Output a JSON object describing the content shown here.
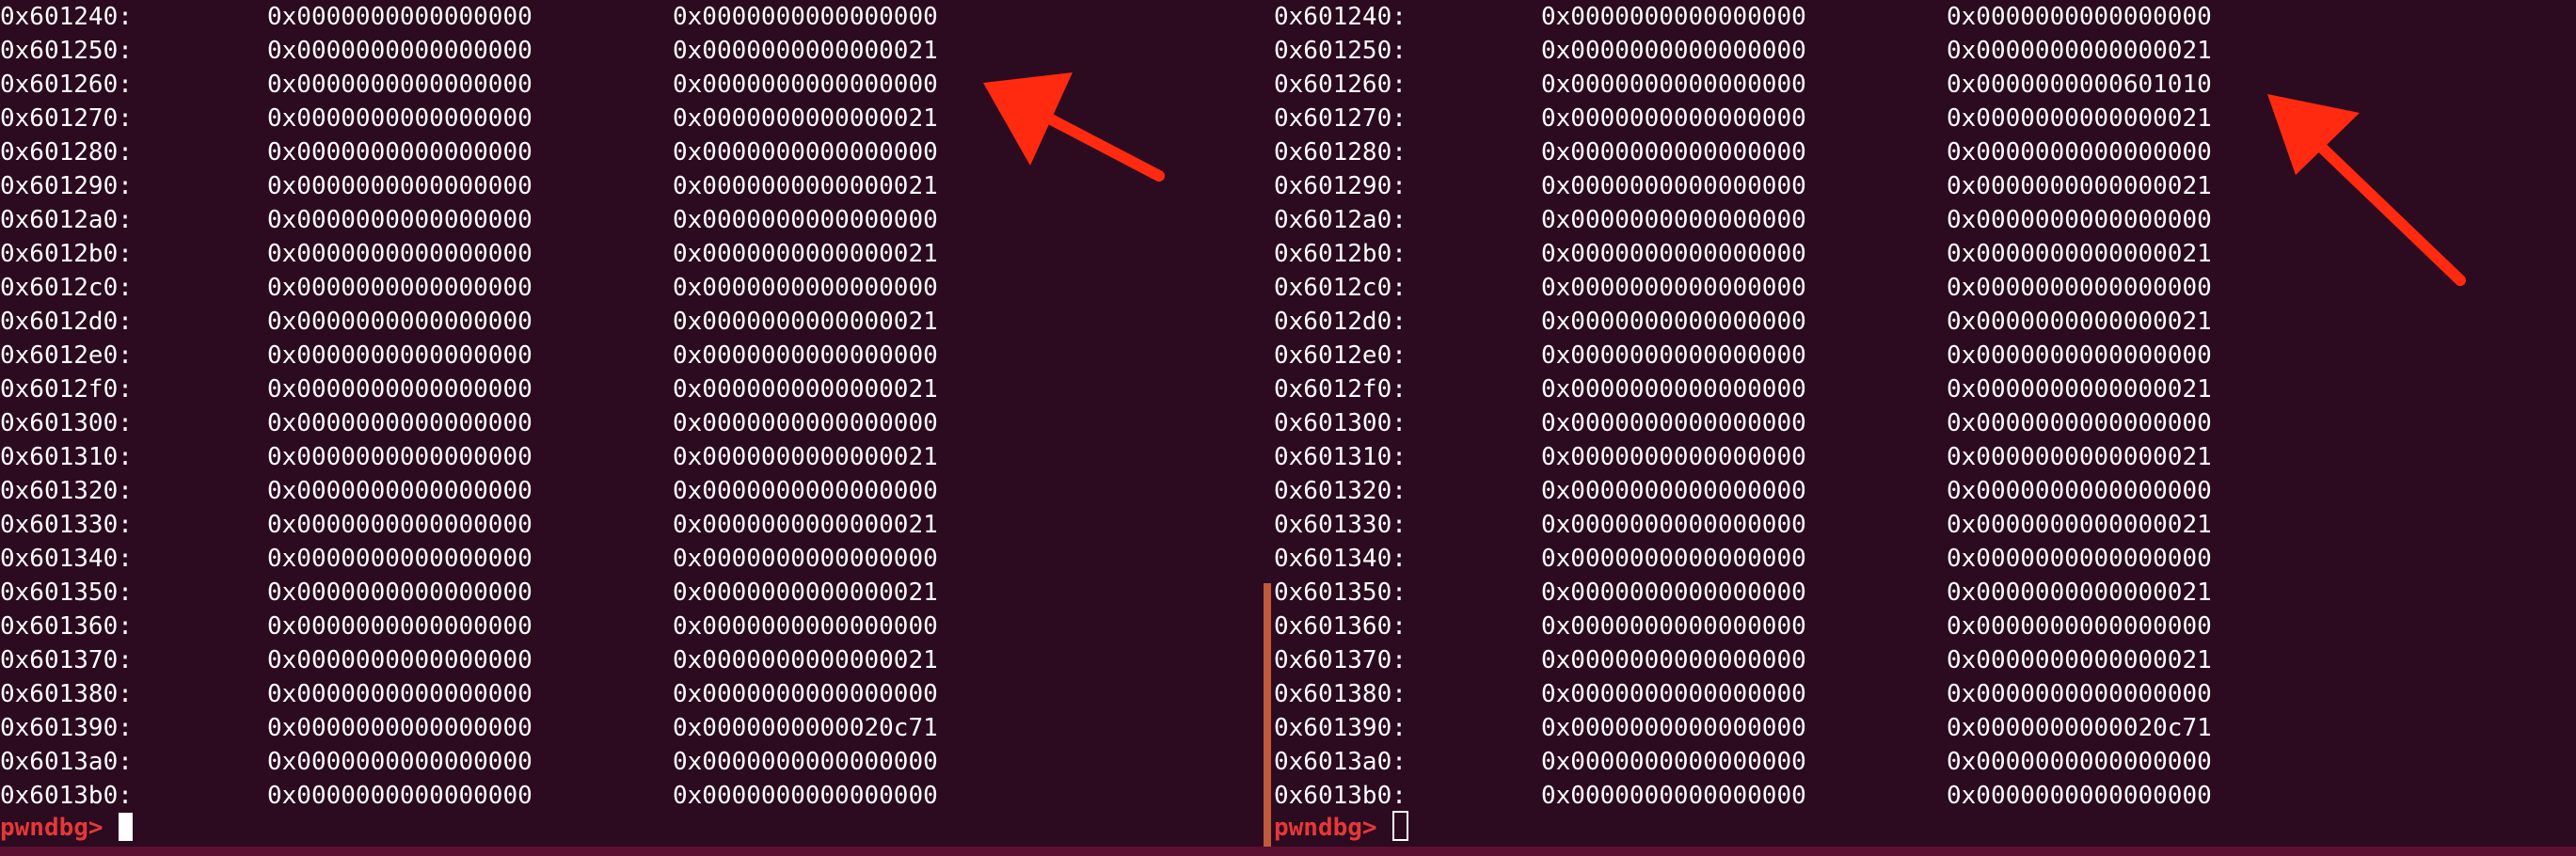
{
  "terminal": {
    "accent_color": "#2c0a20",
    "text_color": "#ffffff",
    "prompt_color": "#e53838",
    "arrow_color": "#ff2a10"
  },
  "left_pane": {
    "rows": [
      {
        "addr": "0x601240:",
        "v1": "0x0000000000000000",
        "v2": "0x0000000000000000"
      },
      {
        "addr": "0x601250:",
        "v1": "0x0000000000000000",
        "v2": "0x0000000000000021"
      },
      {
        "addr": "0x601260:",
        "v1": "0x0000000000000000",
        "v2": "0x0000000000000000"
      },
      {
        "addr": "0x601270:",
        "v1": "0x0000000000000000",
        "v2": "0x0000000000000021"
      },
      {
        "addr": "0x601280:",
        "v1": "0x0000000000000000",
        "v2": "0x0000000000000000"
      },
      {
        "addr": "0x601290:",
        "v1": "0x0000000000000000",
        "v2": "0x0000000000000021"
      },
      {
        "addr": "0x6012a0:",
        "v1": "0x0000000000000000",
        "v2": "0x0000000000000000"
      },
      {
        "addr": "0x6012b0:",
        "v1": "0x0000000000000000",
        "v2": "0x0000000000000021"
      },
      {
        "addr": "0x6012c0:",
        "v1": "0x0000000000000000",
        "v2": "0x0000000000000000"
      },
      {
        "addr": "0x6012d0:",
        "v1": "0x0000000000000000",
        "v2": "0x0000000000000021"
      },
      {
        "addr": "0x6012e0:",
        "v1": "0x0000000000000000",
        "v2": "0x0000000000000000"
      },
      {
        "addr": "0x6012f0:",
        "v1": "0x0000000000000000",
        "v2": "0x0000000000000021"
      },
      {
        "addr": "0x601300:",
        "v1": "0x0000000000000000",
        "v2": "0x0000000000000000"
      },
      {
        "addr": "0x601310:",
        "v1": "0x0000000000000000",
        "v2": "0x0000000000000021"
      },
      {
        "addr": "0x601320:",
        "v1": "0x0000000000000000",
        "v2": "0x0000000000000000"
      },
      {
        "addr": "0x601330:",
        "v1": "0x0000000000000000",
        "v2": "0x0000000000000021"
      },
      {
        "addr": "0x601340:",
        "v1": "0x0000000000000000",
        "v2": "0x0000000000000000"
      },
      {
        "addr": "0x601350:",
        "v1": "0x0000000000000000",
        "v2": "0x0000000000000021"
      },
      {
        "addr": "0x601360:",
        "v1": "0x0000000000000000",
        "v2": "0x0000000000000000"
      },
      {
        "addr": "0x601370:",
        "v1": "0x0000000000000000",
        "v2": "0x0000000000000021"
      },
      {
        "addr": "0x601380:",
        "v1": "0x0000000000000000",
        "v2": "0x0000000000000000"
      },
      {
        "addr": "0x601390:",
        "v1": "0x0000000000000000",
        "v2": "0x0000000000020c71"
      },
      {
        "addr": "0x6013a0:",
        "v1": "0x0000000000000000",
        "v2": "0x0000000000000000"
      },
      {
        "addr": "0x6013b0:",
        "v1": "0x0000000000000000",
        "v2": "0x0000000000000000"
      }
    ],
    "prompt": "pwndbg>"
  },
  "right_pane": {
    "rows": [
      {
        "addr": "0x601240:",
        "v1": "0x0000000000000000",
        "v2": "0x0000000000000000"
      },
      {
        "addr": "0x601250:",
        "v1": "0x0000000000000000",
        "v2": "0x0000000000000021"
      },
      {
        "addr": "0x601260:",
        "v1": "0x0000000000000000",
        "v2": "0x0000000000601010"
      },
      {
        "addr": "0x601270:",
        "v1": "0x0000000000000000",
        "v2": "0x0000000000000021"
      },
      {
        "addr": "0x601280:",
        "v1": "0x0000000000000000",
        "v2": "0x0000000000000000"
      },
      {
        "addr": "0x601290:",
        "v1": "0x0000000000000000",
        "v2": "0x0000000000000021"
      },
      {
        "addr": "0x6012a0:",
        "v1": "0x0000000000000000",
        "v2": "0x0000000000000000"
      },
      {
        "addr": "0x6012b0:",
        "v1": "0x0000000000000000",
        "v2": "0x0000000000000021"
      },
      {
        "addr": "0x6012c0:",
        "v1": "0x0000000000000000",
        "v2": "0x0000000000000000"
      },
      {
        "addr": "0x6012d0:",
        "v1": "0x0000000000000000",
        "v2": "0x0000000000000021"
      },
      {
        "addr": "0x6012e0:",
        "v1": "0x0000000000000000",
        "v2": "0x0000000000000000"
      },
      {
        "addr": "0x6012f0:",
        "v1": "0x0000000000000000",
        "v2": "0x0000000000000021"
      },
      {
        "addr": "0x601300:",
        "v1": "0x0000000000000000",
        "v2": "0x0000000000000000"
      },
      {
        "addr": "0x601310:",
        "v1": "0x0000000000000000",
        "v2": "0x0000000000000021"
      },
      {
        "addr": "0x601320:",
        "v1": "0x0000000000000000",
        "v2": "0x0000000000000000"
      },
      {
        "addr": "0x601330:",
        "v1": "0x0000000000000000",
        "v2": "0x0000000000000021"
      },
      {
        "addr": "0x601340:",
        "v1": "0x0000000000000000",
        "v2": "0x0000000000000000"
      },
      {
        "addr": "0x601350:",
        "v1": "0x0000000000000000",
        "v2": "0x0000000000000021"
      },
      {
        "addr": "0x601360:",
        "v1": "0x0000000000000000",
        "v2": "0x0000000000000000"
      },
      {
        "addr": "0x601370:",
        "v1": "0x0000000000000000",
        "v2": "0x0000000000000021"
      },
      {
        "addr": "0x601380:",
        "v1": "0x0000000000000000",
        "v2": "0x0000000000000000"
      },
      {
        "addr": "0x601390:",
        "v1": "0x0000000000000000",
        "v2": "0x0000000000020c71"
      },
      {
        "addr": "0x6013a0:",
        "v1": "0x0000000000000000",
        "v2": "0x0000000000000000"
      },
      {
        "addr": "0x6013b0:",
        "v1": "0x0000000000000000",
        "v2": "0x0000000000000000"
      }
    ],
    "prompt": "pwndbg>"
  },
  "annotations": {
    "left_arrow_icon": "arrow-pointing-left",
    "right_arrow_icon": "arrow-pointing-left"
  }
}
